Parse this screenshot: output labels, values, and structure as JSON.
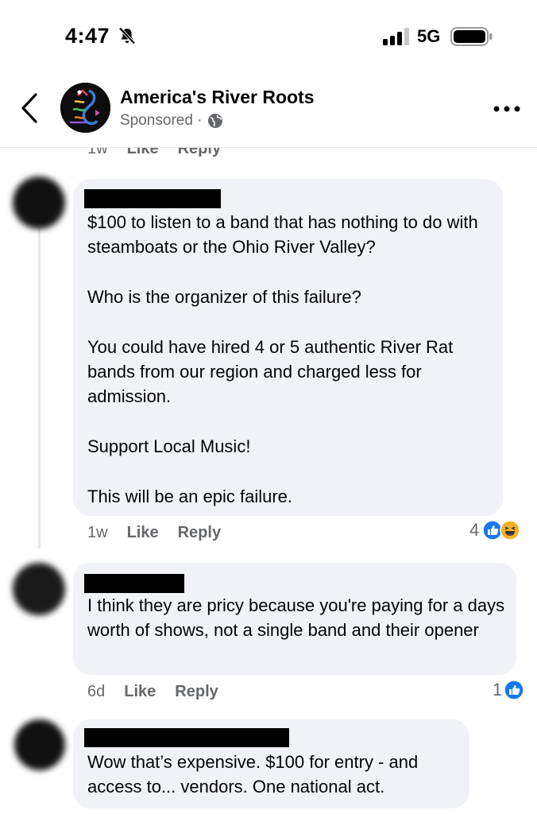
{
  "status": {
    "time": "4:47",
    "network": "5G"
  },
  "header": {
    "page_name": "America's River Roots",
    "sponsored": "Sponsored ·"
  },
  "previous_comment_meta": {
    "age": "1w",
    "like": "Like",
    "reply": "Reply"
  },
  "comments": [
    {
      "paragraphs": [
        "$100 to listen to a band that has nothing to do with steamboats or the Ohio River Valley?",
        "Who is the organizer of this failure?",
        "You could have hired 4 or 5 authentic River Rat bands from our region and charged less for admission.",
        "Support Local Music!",
        "This will be an epic failure."
      ],
      "age": "1w",
      "like": "Like",
      "reply": "Reply",
      "reaction_count": "4",
      "reactions": [
        "like-icon",
        "haha-icon"
      ]
    },
    {
      "paragraphs": [
        "I think they are pricy because you're paying for a days worth of shows, not a single band and their opener"
      ],
      "age": "6d",
      "like": "Like",
      "reply": "Reply",
      "reaction_count": "1",
      "reactions": [
        "like-icon"
      ]
    },
    {
      "paragraphs": [
        "Wow that’s expensive. $100 for entry - and access to... vendors. One national act."
      ]
    }
  ],
  "colors": {
    "like_blue": "#1877f2",
    "bubble": "#f0f2f5",
    "meta_grey": "#65676b"
  }
}
